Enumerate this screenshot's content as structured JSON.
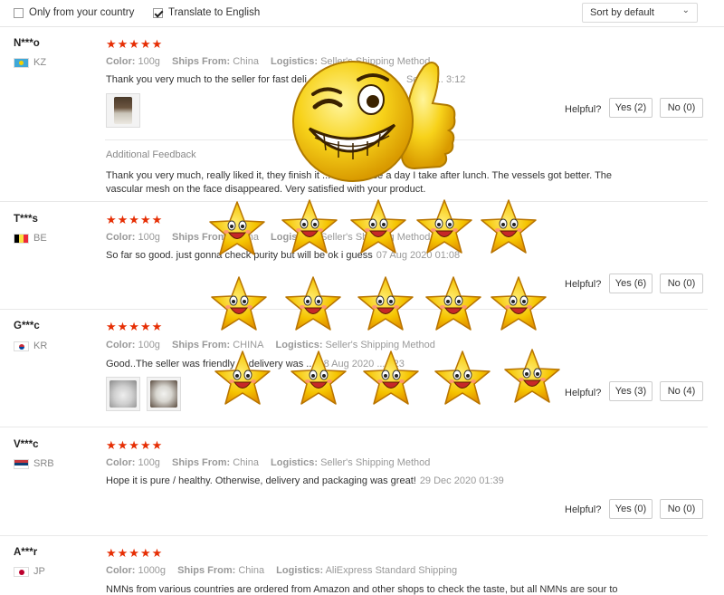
{
  "filters": {
    "only_country_label": "Only from your country",
    "translate_label": "Translate to English",
    "sort_label": "Sort by default"
  },
  "labels": {
    "color": "Color:",
    "ships_from": "Ships From:",
    "logistics": "Logistics:",
    "helpful": "Helpful?",
    "additional_feedback": "Additional Feedback"
  },
  "reviews": [
    {
      "user": "N***o",
      "country": "KZ",
      "stars": "★★★★★",
      "color": "100g",
      "ships_from": "China",
      "logistics": "Seller's Shipping Method",
      "text": "Thank you very much to the seller for fast deli",
      "date": "Sep 2 ... 3:12",
      "yes": "Yes (2)",
      "no": "No (0)",
      "additional_text": "Thank you very much, really liked it, they finish it ... asks. Once a day I take after lunch. The vessels got better. The vascular mesh on the face disappeared. Very satisfied with your product."
    },
    {
      "user": "T***s",
      "country": "BE",
      "stars": "★★★★★",
      "color": "100g",
      "ships_from": "China",
      "logistics": "Seller's Shipping Method",
      "text": "So far so good. just gonna check purity but will be ok i guess",
      "date": "07 Aug 2020 01:08",
      "yes": "Yes (6)",
      "no": "No (0)"
    },
    {
      "user": "G***c",
      "country": "KR",
      "stars": "★★★★★",
      "color": "100g",
      "ships_from": "CHINA",
      "logistics": "Seller's Shipping Method",
      "text": "Good..The seller was friendly ... delivery was ...",
      "date": "08 Aug 2020 ...4:23",
      "yes": "Yes (3)",
      "no": "No (4)"
    },
    {
      "user": "V***c",
      "country": "SRB",
      "stars": "★★★★★",
      "color": "100g",
      "ships_from": "China",
      "logistics": "Seller's Shipping Method",
      "text": "Hope it is pure / healthy. Otherwise, delivery and packaging was great!",
      "date": "29 Dec 2020 01:39",
      "yes": "Yes (0)",
      "no": "No (0)"
    },
    {
      "user": "A***r",
      "country": "JP",
      "stars": "★★★★★",
      "color": "1000g",
      "ships_from": "China",
      "logistics": "AliExpress Standard Shipping",
      "text": "NMNs from various countries are ordered from Amazon and other shops to check the taste, but all NMNs are sour to"
    }
  ]
}
